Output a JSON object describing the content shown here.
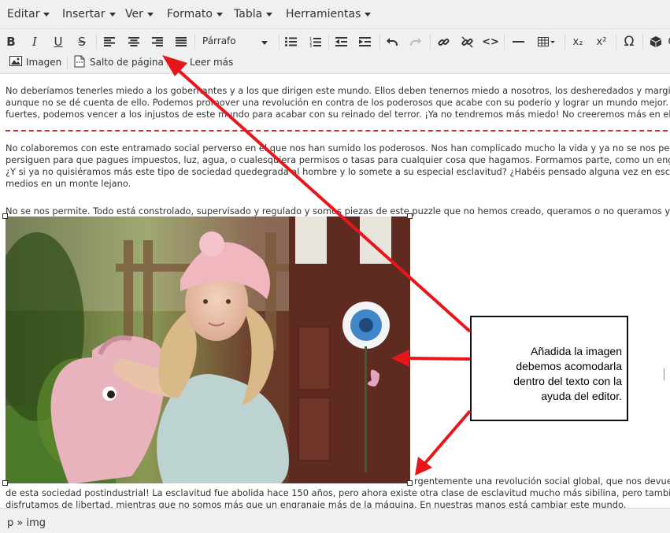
{
  "menubar": {
    "items": [
      "Editar",
      "Insertar",
      "Ver",
      "Formato",
      "Tabla",
      "Herramientas"
    ]
  },
  "toolbar": {
    "format_select": "Párrafo",
    "insert_image_label": "Imagen",
    "page_break_label": "Salto de página",
    "read_more_label": "Leer más",
    "bold_glyph": "B",
    "italic_glyph": "I",
    "underline_glyph": "U",
    "strike_glyph": "S",
    "code_glyph": "<>",
    "omega_glyph": "Ω",
    "subscript_glyph": "x₂",
    "superscript_glyph": "x²"
  },
  "content": {
    "paragraph1": [
      "No deberíamos tenerles miedo a los gobernantes y a los que dirigen este mundo. Ellos deben tenernos miedo a nosotros, los desheredados y marginados, la",
      "aunque no se dé cuenta de ello. Podemos promover una revolución en contra de los poderosos que acabe con su poderío y lograr un mundo mejor. Come",
      "fuertes, podemos vencer a los injustos de este mundo para acabar con su reinado del terror. ¡Ya no tendremos más miedo! No creeremos más en el miedo"
    ],
    "paragraph2": [
      "No colaboremos con este entramado social perverso en el que nos han sumido los poderosos. Nos han complicado mucho la vida y ya no se nos permite ni",
      "persiguen para que pagues impuestos, luz, agua, o cualesquiera permisos o tasas para cualquier cosa que hagamos. Formamos parte, como un engranaje m",
      "¿Y si ya no quisiéramos más este tipo de sociedad quedegrada al hombre y lo somete a su especial esclavitud? ¿Habéis pensado alguna vez en escapara? ¡I",
      "medios en un monte lejano."
    ],
    "paragraph3": "No se nos permite. Todo está constrolado, supervisado y regulado y somos piezas de este puzzle que no hemos creado, queramos o no queramos y no no",
    "paragraph4_inline": "rgentemente una revolución social global, que nos devuelva",
    "paragraph4": [
      "de esta sociedad postindustrial! La esclavitud fue abolida hace 150 años, pero ahora existe otra clase de esclavitud mucho más sibilina, pero también perve",
      "disfrutamos de libertad, mientras que no somos más que un engranaje más de la máquina. En nuestras manos está cambiar este mundo."
    ]
  },
  "statusbar": {
    "path": "p » img"
  },
  "annotation": {
    "lines": [
      "Añadida la imagen",
      "debemos acomodarla",
      "dentro del texto con la",
      "ayuda del editor."
    ]
  },
  "colors": {
    "arrow": "#e8151b",
    "toolbar_bg": "#f0f0f0",
    "pagebreak": "#cc2b2b"
  }
}
